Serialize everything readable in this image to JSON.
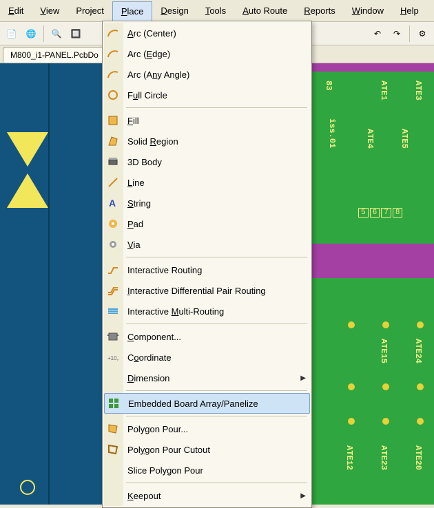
{
  "menubar": {
    "items": [
      {
        "u": "E",
        "rest": "dit"
      },
      {
        "u": "V",
        "rest": "iew"
      },
      {
        "u": "",
        "pre": "Pro",
        "u2": "j",
        "post": "ect"
      },
      {
        "u": "P",
        "rest": "lace",
        "active": true
      },
      {
        "u": "D",
        "rest": "esign"
      },
      {
        "u": "T",
        "rest": "ools"
      },
      {
        "u": "A",
        "rest": "uto Route"
      },
      {
        "u": "R",
        "rest": "eports"
      },
      {
        "u": "W",
        "rest": "indow"
      },
      {
        "u": "H",
        "rest": "elp"
      }
    ]
  },
  "tab": {
    "label": "M800_i1-PANEL.PcbDo"
  },
  "dropdown": {
    "groups": [
      [
        {
          "icon": "arc-center",
          "label": "Arc (Center)",
          "u": "A"
        },
        {
          "icon": "arc-edge",
          "label": "Arc (Edge)",
          "u": "E"
        },
        {
          "icon": "arc-any",
          "label": "Arc (Any Angle)",
          "u": "n"
        },
        {
          "icon": "full-circle",
          "label": "Full Circle",
          "u": "u"
        }
      ],
      [
        {
          "icon": "fill",
          "label": "Fill",
          "u": "F"
        },
        {
          "icon": "solid-region",
          "label": "Solid Region",
          "u": "R"
        },
        {
          "icon": "3d-body",
          "label": "3D Body",
          "u": ""
        },
        {
          "icon": "line",
          "label": "Line",
          "u": "L"
        },
        {
          "icon": "string",
          "label": "String",
          "u": "S"
        },
        {
          "icon": "pad",
          "label": "Pad",
          "u": "P"
        },
        {
          "icon": "via",
          "label": "Via",
          "u": "V"
        }
      ],
      [
        {
          "icon": "route",
          "label": "Interactive Routing",
          "u": ""
        },
        {
          "icon": "diff-route",
          "label": "Interactive Differential Pair Routing",
          "u": "I"
        },
        {
          "icon": "multi-route",
          "label": "Interactive Multi-Routing",
          "u": "M"
        }
      ],
      [
        {
          "icon": "component",
          "label": "Component...",
          "u": "C"
        },
        {
          "icon": "coordinate",
          "label": "Coordinate",
          "u": "o"
        },
        {
          "icon": "",
          "label": "Dimension",
          "u": "D",
          "submenu": true
        }
      ],
      [
        {
          "icon": "embedded",
          "label": "Embedded Board Array/Panelize",
          "u": "",
          "highlight": true
        }
      ],
      [
        {
          "icon": "poly-pour",
          "label": "Polygon Pour...",
          "u": "G"
        },
        {
          "icon": "poly-cutout",
          "label": "Polygon Pour Cutout",
          "u": "y"
        },
        {
          "icon": "",
          "label": "Slice Polygon Pour",
          "u": ""
        }
      ],
      [
        {
          "icon": "",
          "label": "Keepout",
          "u": "K",
          "submenu": true
        }
      ]
    ]
  },
  "pcb": {
    "refs_top": [
      "83",
      "ATE1",
      "ATE3",
      "iss.01",
      "ATE4",
      "ATE5"
    ],
    "pins": [
      "5",
      "6",
      "7",
      "8"
    ],
    "refs_bot": [
      "ATE15",
      "ATE24",
      "ATE12",
      "ATE23",
      "ATE20"
    ]
  }
}
